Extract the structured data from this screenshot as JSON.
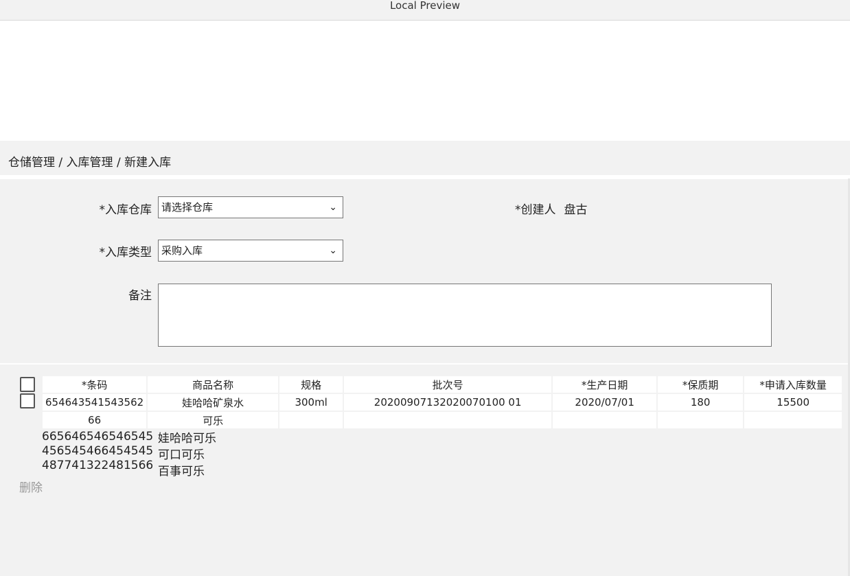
{
  "window": {
    "title": "Local Preview"
  },
  "breadcrumb": "仓储管理 / 入库管理 / 新建入库",
  "form": {
    "warehouse_label": "*入库仓库",
    "warehouse_value": "请选择仓库",
    "type_label": "*入库类型",
    "type_value": "采购入库",
    "remark_label": "备注",
    "creator_label": "*创建人",
    "creator_value": "盘古"
  },
  "table": {
    "headers": [
      "*条码",
      "商品名称",
      "规格",
      "批次号",
      "*生产日期",
      "*保质期",
      "*申请入库数量"
    ],
    "rows": [
      [
        "654643541543562",
        "娃哈哈矿泉水",
        "300ml",
        "20200907132020070100 01",
        "2020/07/01",
        "180",
        "15500"
      ],
      [
        "66",
        "可乐",
        "",
        "",
        "",
        "",
        ""
      ]
    ]
  },
  "suggestions": {
    "barcodes": [
      "665646546546545",
      "456545466454545",
      "487741322481566"
    ],
    "names": [
      "娃哈哈可乐",
      "可口可乐",
      "百事可乐"
    ]
  },
  "actions": {
    "delete_label": "删除"
  }
}
